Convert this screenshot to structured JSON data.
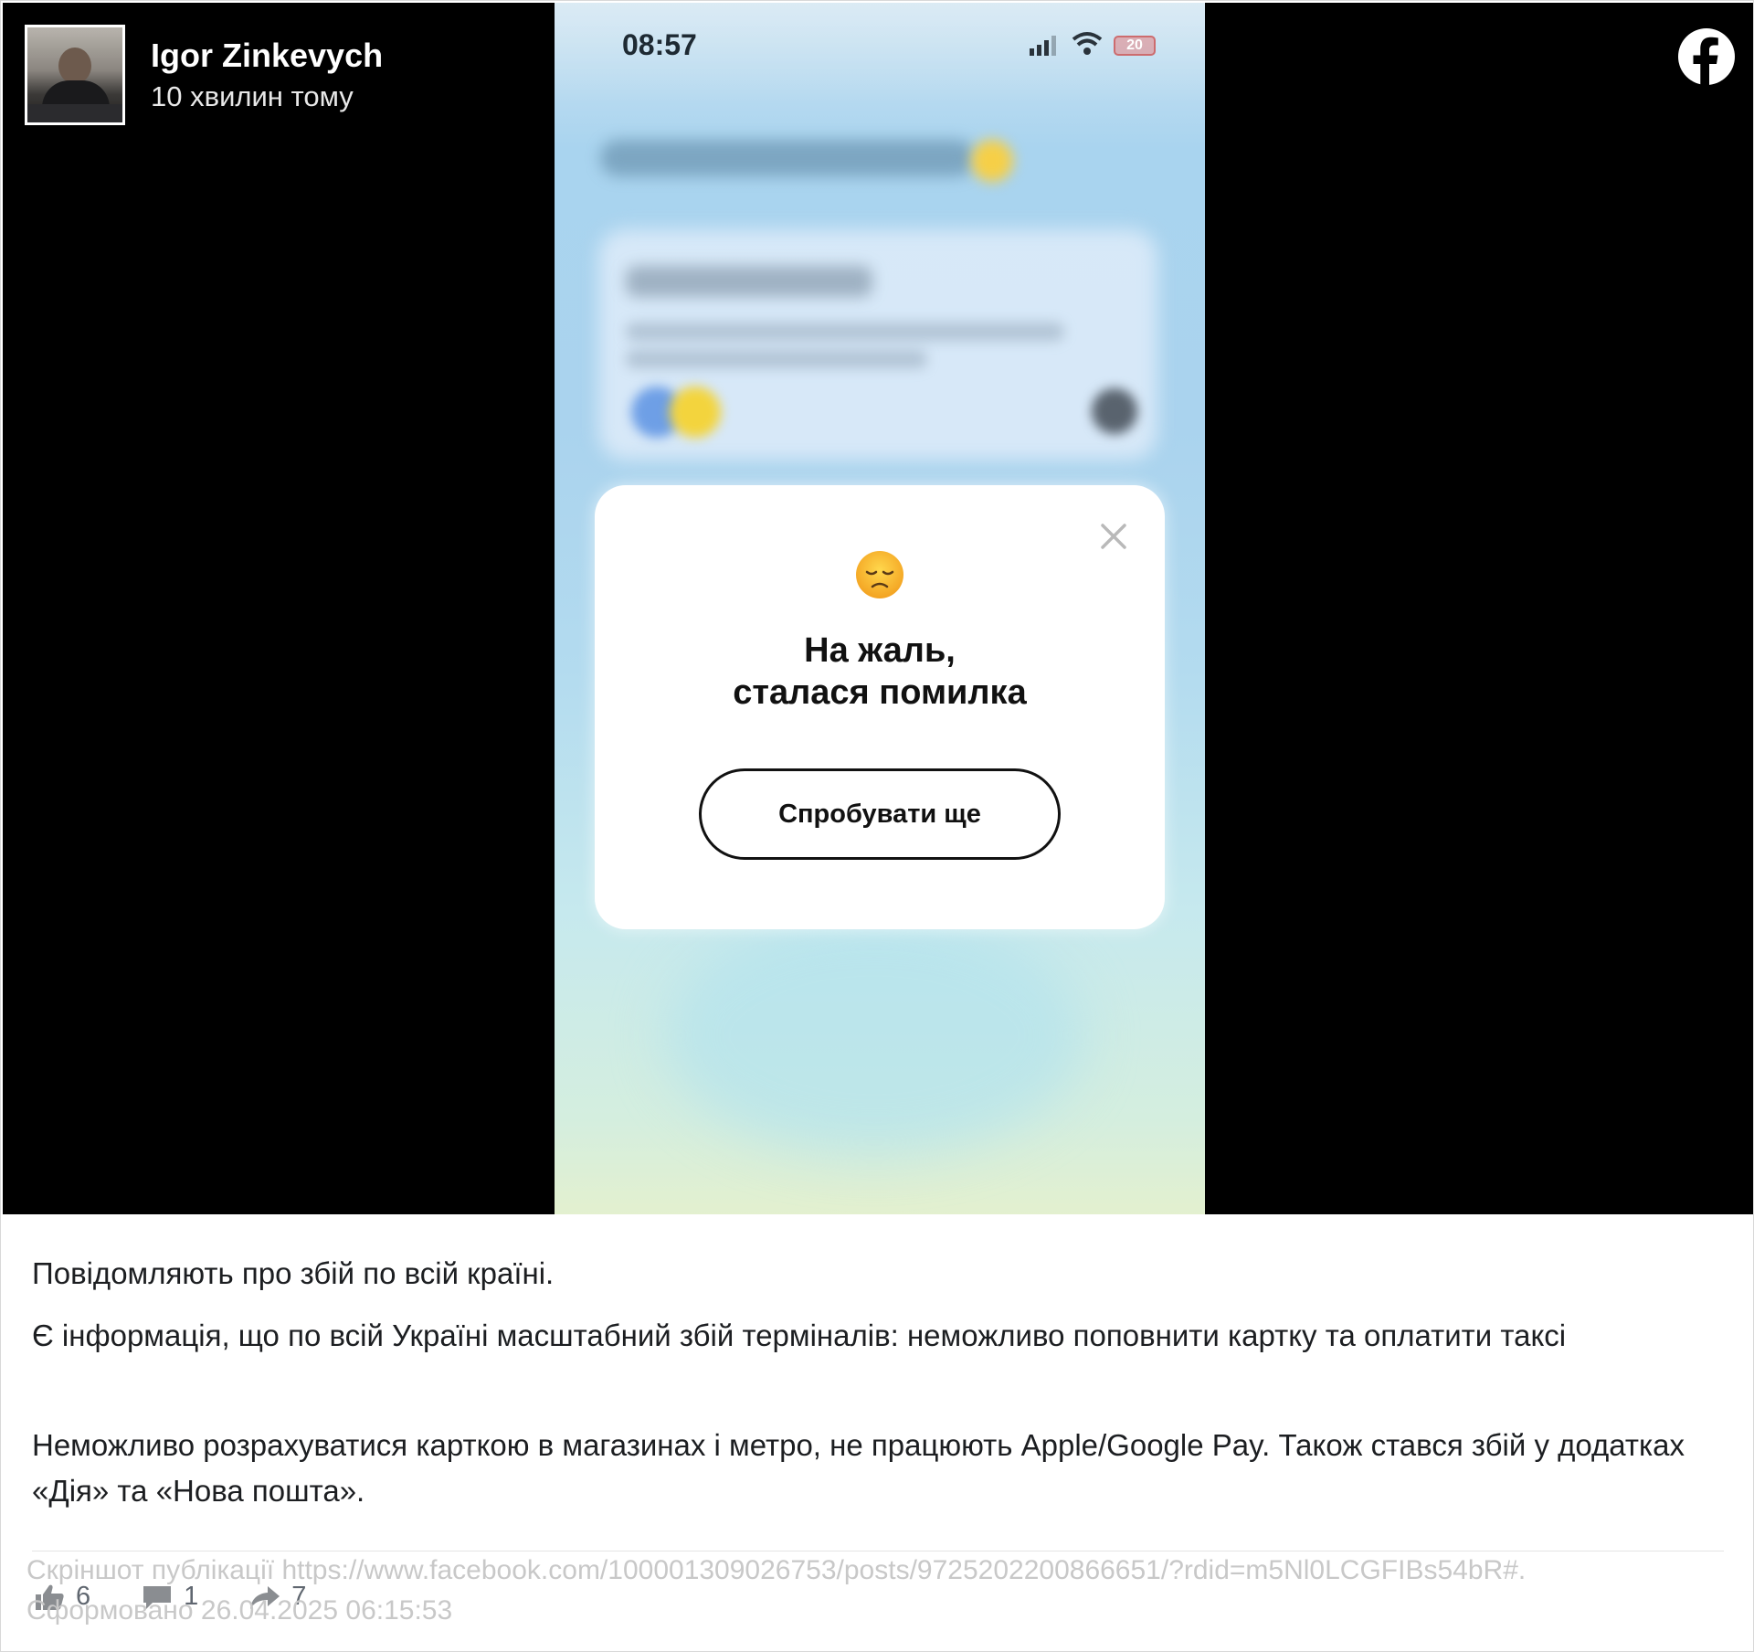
{
  "author": {
    "name": "Igor Zinkevych",
    "time": "10 хвилин тому"
  },
  "brand_icon": "facebook-icon",
  "phone": {
    "clock": "08:57",
    "battery": "20",
    "dialog": {
      "emoji": "disappointed-face-icon",
      "title": "На жаль,\nсталася помилка",
      "button": "Спробувати ще"
    }
  },
  "post": {
    "paragraphs": [
      "Повідомляють про збій по всій країні.",
      "Є інформація, що по всій Україні масштабний збій терміналів: неможливо поповнити картку та оплатити таксі",
      "Неможливо розрахуватися карткою в магазинах і метро, не працюють Apple/Google Pay. Також стався збій у додатках «Дія» та «Нова пошта»."
    ]
  },
  "stats": {
    "likes": "6",
    "comments": "1",
    "shares": "7"
  },
  "footer": {
    "line1": "Скріншот публікації https://www.facebook.com/100001309026753/posts/9725202200866651/?rdid=m5Nl0LCGFIBs54bR#.",
    "line2": "Сформовано 26.04.2025 06:15:53"
  },
  "colors": {
    "media_background": "#000000",
    "text": "#1c1e21",
    "footer_text": "#c8c8c8"
  }
}
